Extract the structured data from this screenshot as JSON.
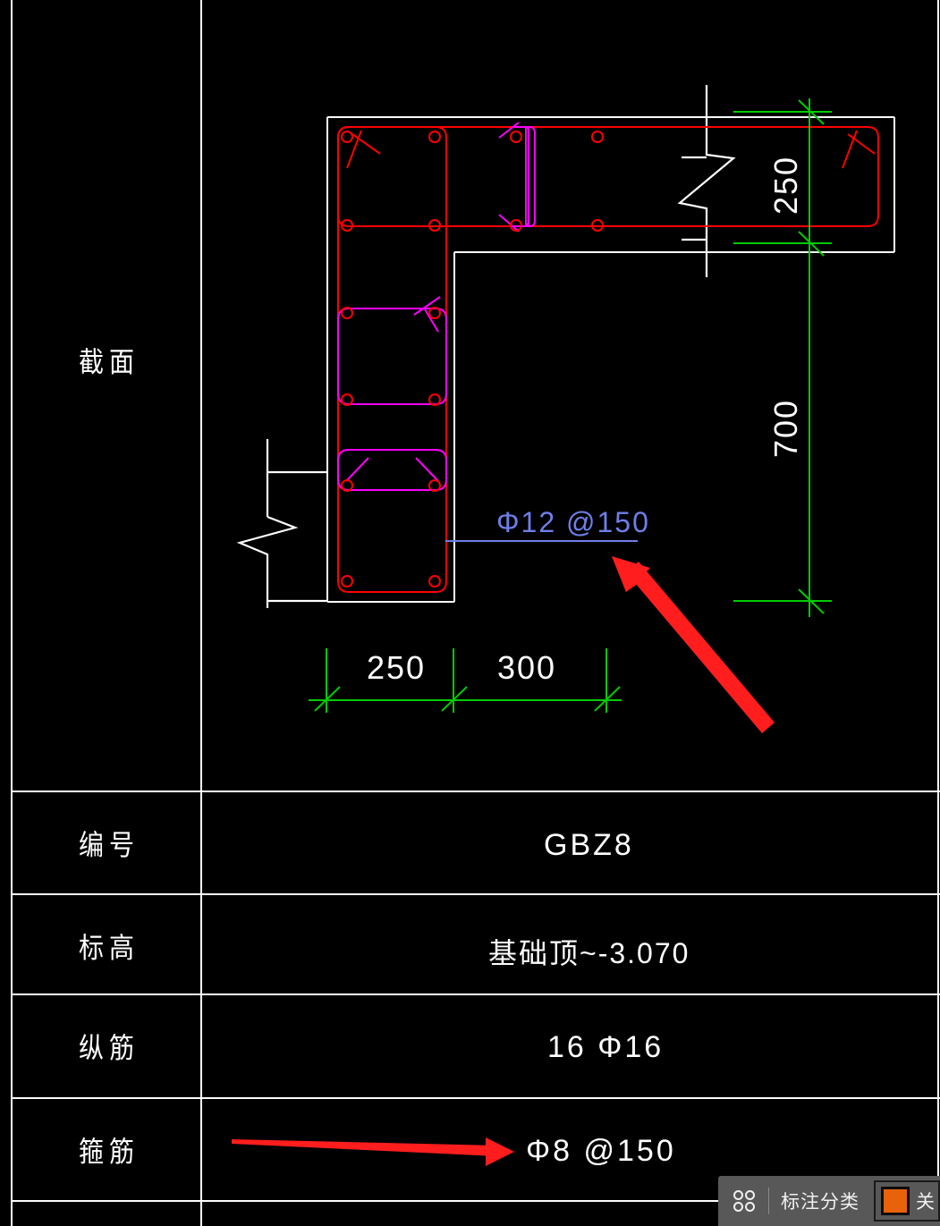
{
  "drawing": {
    "title_row_label": "截面",
    "rebar_note": "Φ12 @150",
    "dimensions": {
      "horizontal": [
        "250",
        "300"
      ],
      "vertical": [
        "250",
        "700"
      ]
    },
    "colors": {
      "background": "#000000",
      "table_line": "#ffffff",
      "outline": "#ffffff",
      "stirrup_outer": "#ff0000",
      "stirrup_inner": "#ff00ff",
      "bar": "#ff0000",
      "dimension": "#00cc00",
      "note_text": "#6f7fe8",
      "annotation_arrow": "#ff1d1d",
      "toolbar_bg": "#585858",
      "swatch": "#e8620c"
    }
  },
  "table": {
    "rows": [
      {
        "label": "截面",
        "value": ""
      },
      {
        "label": "编号",
        "value": "GBZ8"
      },
      {
        "label": "标高",
        "value": "基础顶~-3.070"
      },
      {
        "label": "纵筋",
        "value": "16 Φ16"
      },
      {
        "label": "箍筋",
        "value": "Φ8 @150"
      }
    ]
  },
  "toolbar": {
    "grid_icon": "grid-four-squares-icon",
    "label": "标注分类",
    "swatch_color": "#e8620c",
    "swatch_label": "关"
  }
}
